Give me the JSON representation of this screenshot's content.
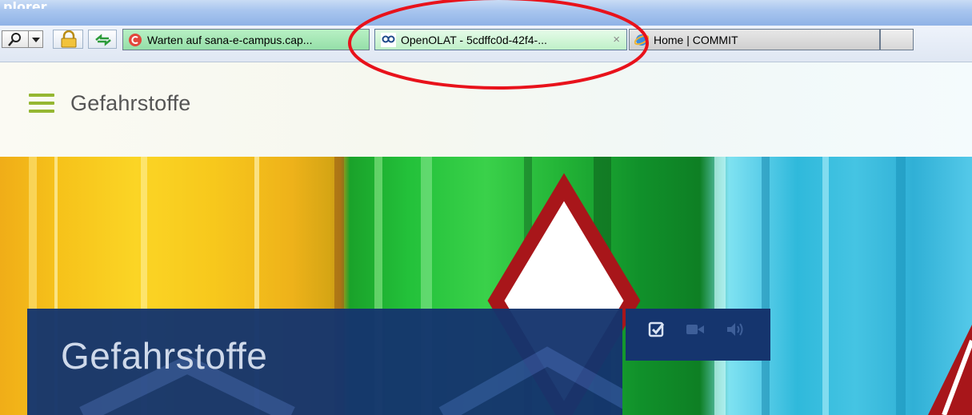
{
  "window": {
    "title": "plorer"
  },
  "tabs": [
    {
      "label": "Warten auf sana-e-campus.cap...",
      "icon": "loading-c-icon"
    },
    {
      "label": "OpenOLAT - 5cdffc0d-42f4-...",
      "icon": "openolat-icon",
      "active": true,
      "close": "×"
    },
    {
      "label": "Home | COMMIT",
      "icon": "ie-icon"
    }
  ],
  "page": {
    "header_title": "Gefahrstoffe",
    "hero_title": "Gefahrstoffe",
    "media_icons": [
      "checkbox-icon",
      "video-icon",
      "audio-icon"
    ]
  },
  "colors": {
    "accent_green": "#95b732",
    "navy_overlay": "#15356e",
    "annotation_red": "#e8121b"
  }
}
